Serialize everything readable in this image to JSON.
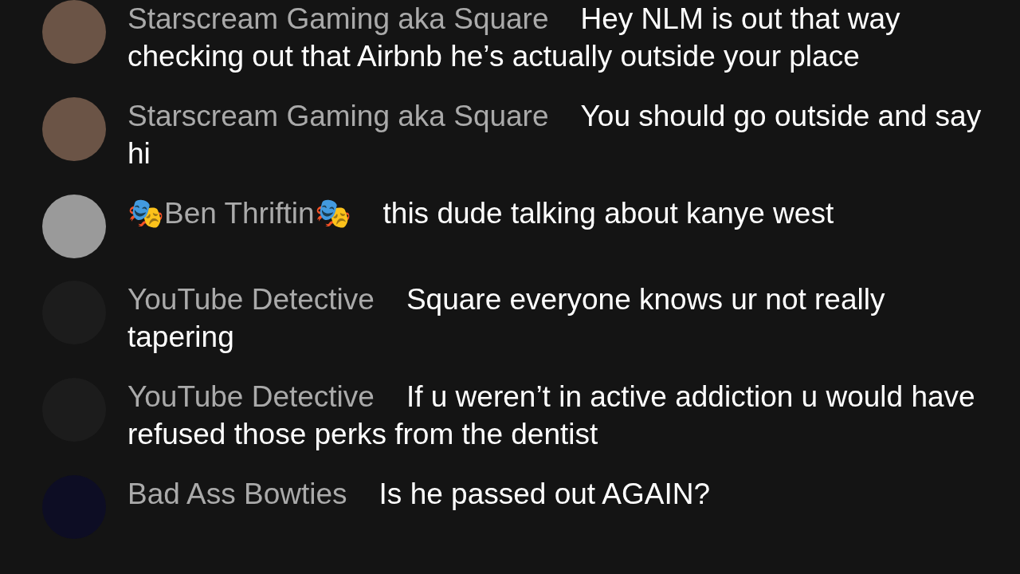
{
  "messages": [
    {
      "author": "Starscream Gaming aka Square",
      "text": "Hey NLM is out that way checking out that Airbnb he’s actually outside your place",
      "color": "#6b5446"
    },
    {
      "author": "Starscream Gaming aka Square",
      "text": "You should go outside and say hi",
      "color": "#6b5446"
    },
    {
      "author": "🎭Ben Thriftin🎭",
      "text": "this dude talking about kanye west",
      "color": "#9a9a9a"
    },
    {
      "author": "YouTube Detective",
      "text": "Square everyone knows ur not really tapering",
      "color": "#1c1c1c"
    },
    {
      "author": "YouTube Detective",
      "text": "If u weren’t in active addiction u would have refused those perks from the dentist",
      "color": "#1c1c1c"
    },
    {
      "author": "Bad Ass Bowties",
      "text": "Is he passed out AGAIN?",
      "color": "#0d0d24"
    }
  ]
}
